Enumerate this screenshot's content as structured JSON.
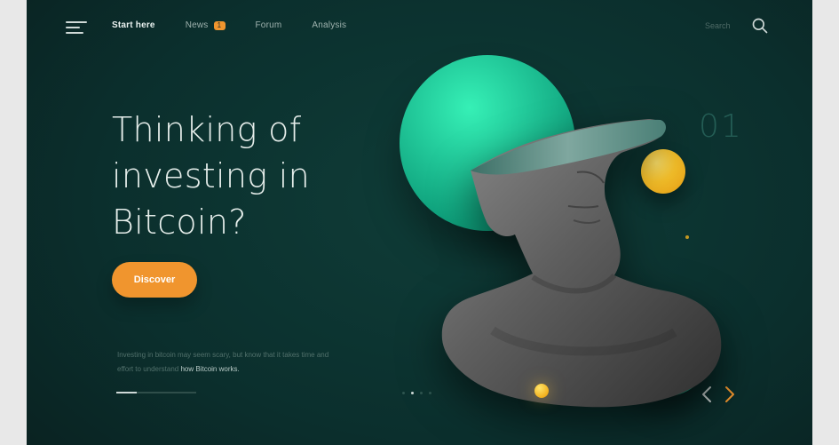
{
  "nav": {
    "items": [
      {
        "label": "Start here",
        "active": true
      },
      {
        "label": "News",
        "badge": "1"
      },
      {
        "label": "Forum"
      },
      {
        "label": "Analysis"
      }
    ],
    "search_placeholder": "Search"
  },
  "hero": {
    "headline_lines": [
      "Thinking of",
      "investing in",
      "Bitcoin?"
    ],
    "cta_label": "Discover",
    "blurb_prefix": "Investing in bitcoin may seem scary, but know that it takes time and effort to understand",
    "blurb_emphasis": "how Bitcoin works."
  },
  "slider": {
    "index": "01",
    "progress_fraction": 0.25,
    "dots_count": 4,
    "active_dot": 1
  },
  "colors": {
    "accent_orange": "#f0952e",
    "mint": "#22c99a",
    "background_dark": "#0b2f2d"
  },
  "icons": {
    "menu": "menu-icon",
    "search": "search-icon",
    "prev": "chevron-left-icon",
    "next": "chevron-right-icon"
  }
}
